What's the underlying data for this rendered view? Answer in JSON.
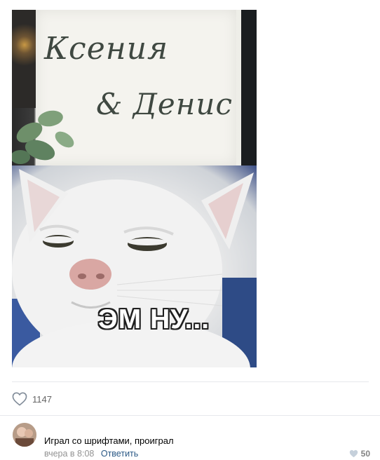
{
  "post": {
    "image_alt": "Wedding sign meme with skeptical white cat",
    "wedding_sign": {
      "line1": "Ксения",
      "line2": "& Денис"
    },
    "cat_caption": "ЭМ НУ..."
  },
  "likes": {
    "count": "1147",
    "icon": "heart-icon"
  },
  "comment": {
    "text": "Играл со шрифтами, проиграл",
    "time": "вчера в 8:08",
    "reply_label": "Ответить",
    "like_count": "50",
    "like_icon": "heart-icon"
  },
  "colors": {
    "link": "#2a5885",
    "muted": "#939393",
    "divider": "#e7e8ec"
  }
}
